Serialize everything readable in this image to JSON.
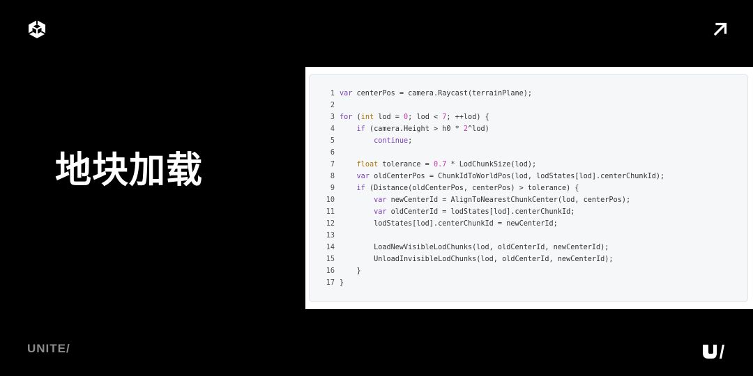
{
  "slide": {
    "title": "地块加载"
  },
  "header": {
    "logo_icon": "unity-cube-icon",
    "link_icon": "arrow-up-right-icon"
  },
  "footer": {
    "wordmark": "UNITE/",
    "badge_icon": "u-slash-logo-icon"
  },
  "code": {
    "language": "pseudo-csharp",
    "colors": {
      "keyword": "#7b3fbf",
      "type": "#b07400",
      "number": "#c23fa9",
      "text": "#2f3337",
      "background": "#f6f7f8"
    },
    "lines": [
      {
        "num": "1",
        "text": "var centerPos = camera.Raycast(terrainPlane);"
      },
      {
        "num": "2",
        "text": ""
      },
      {
        "num": "3",
        "text": "for (int lod = 0; lod < 7; ++lod) {"
      },
      {
        "num": "4",
        "text": "    if (camera.Height > h0 * 2^lod)"
      },
      {
        "num": "5",
        "text": "        continue;"
      },
      {
        "num": "6",
        "text": ""
      },
      {
        "num": "7",
        "text": "    float tolerance = 0.7 * LodChunkSize(lod);"
      },
      {
        "num": "8",
        "text": "    var oldCenterPos = ChunkIdToWorldPos(lod, lodStates[lod].centerChunkId);"
      },
      {
        "num": "9",
        "text": "    if (Distance(oldCenterPos, centerPos) > tolerance) {"
      },
      {
        "num": "10",
        "text": "        var newCenterId = AlignToNearestChunkCenter(lod, centerPos);"
      },
      {
        "num": "11",
        "text": "        var oldCenterId = lodStates[lod].centerChunkId;"
      },
      {
        "num": "12",
        "text": "        lodStates[lod].centerChunkId = newCenterId;"
      },
      {
        "num": "13",
        "text": ""
      },
      {
        "num": "14",
        "text": "        LoadNewVisibleLodChunks(lod, oldCenterId, newCenterId);"
      },
      {
        "num": "15",
        "text": "        UnloadInvisibleLodChunks(lod, oldCenterId, newCenterId);"
      },
      {
        "num": "16",
        "text": "    }"
      },
      {
        "num": "17",
        "text": "}"
      }
    ]
  }
}
